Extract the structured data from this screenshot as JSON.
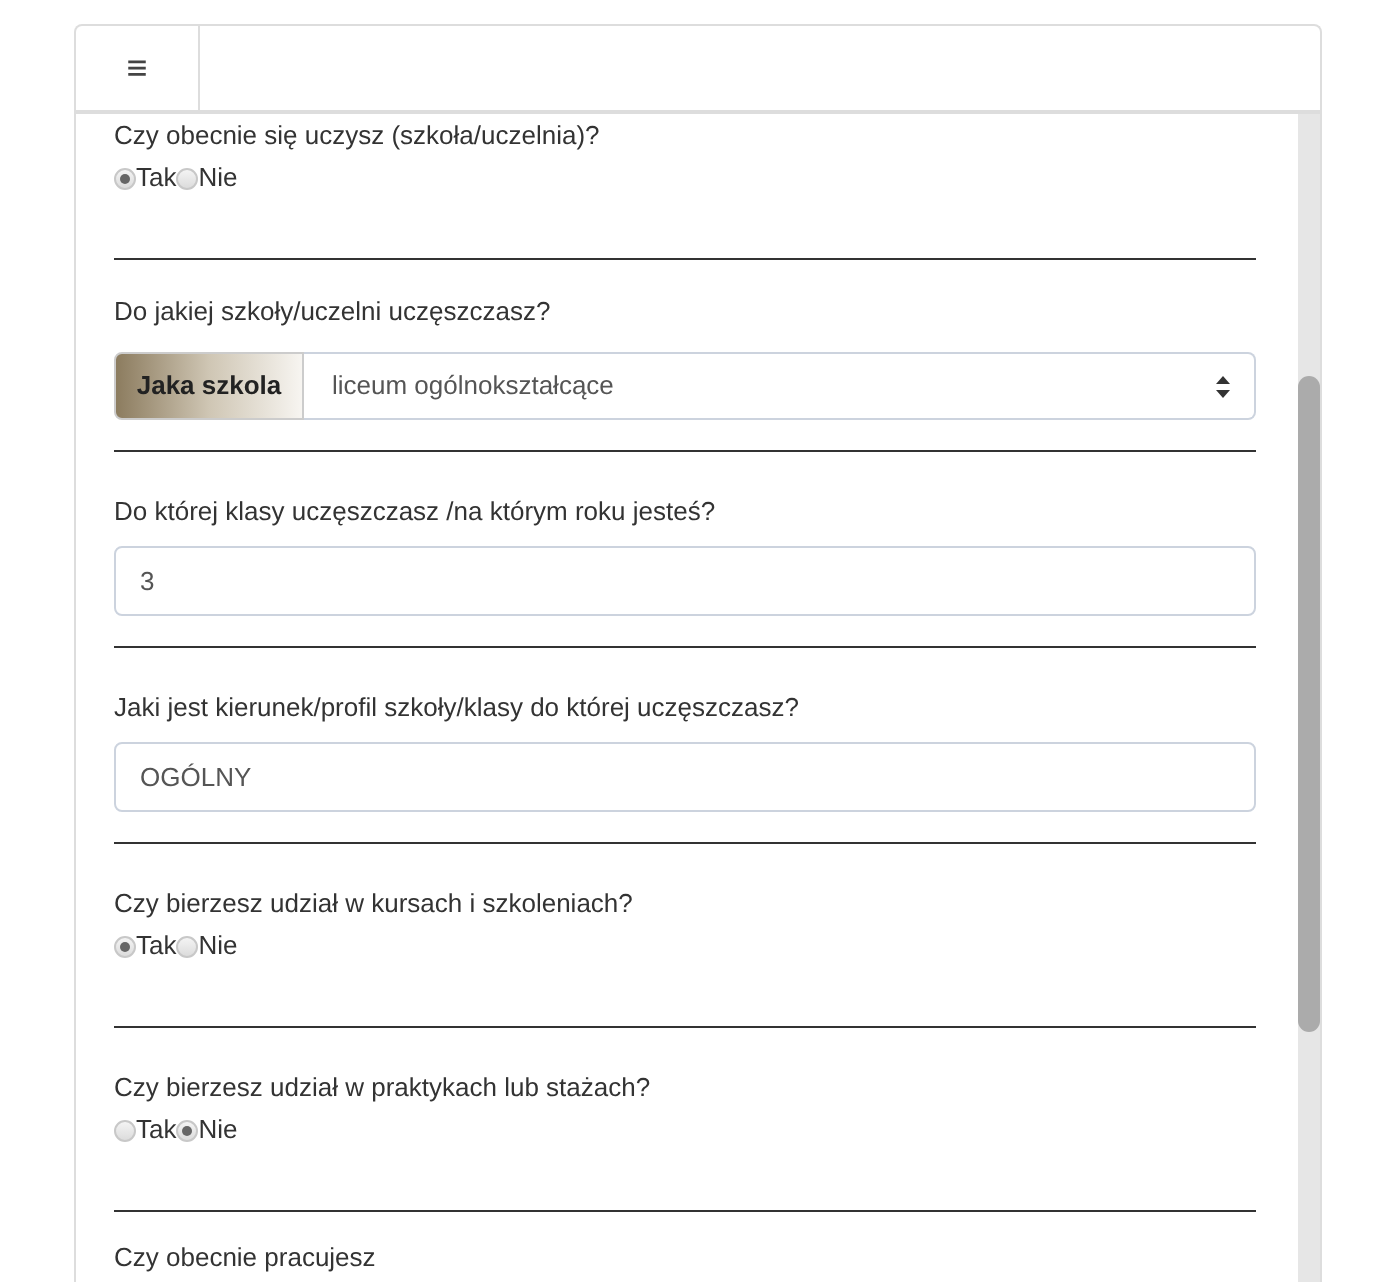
{
  "header": {
    "menu_icon": "≡"
  },
  "questions": [
    {
      "kind": "radio",
      "label": "Czy obecnie się uczysz (szkoła/uczelnia)?",
      "options": [
        {
          "label": "Tak",
          "selected": true
        },
        {
          "label": "Nie",
          "selected": false
        }
      ]
    },
    {
      "kind": "select",
      "label": "Do jakiej szkoły/uczelni uczęszczasz?",
      "addon": "Jaka szkola",
      "value": "liceum ogólnokształcące"
    },
    {
      "kind": "text",
      "label": "Do której klasy uczęszczasz /na którym roku jesteś?",
      "value": "3"
    },
    {
      "kind": "text",
      "label": "Jaki jest kierunek/profil szkoły/klasy do której uczęszczasz?",
      "value": "OGÓLNY"
    },
    {
      "kind": "radio",
      "label": "Czy bierzesz udział w kursach i szkoleniach?",
      "options": [
        {
          "label": "Tak",
          "selected": true
        },
        {
          "label": "Nie",
          "selected": false
        }
      ]
    },
    {
      "kind": "radio",
      "label": "Czy bierzesz udział w praktykach lub stażach?",
      "options": [
        {
          "label": "Tak",
          "selected": false
        },
        {
          "label": "Nie",
          "selected": true
        }
      ]
    },
    {
      "kind": "label",
      "label": "Czy obecnie pracujesz"
    }
  ]
}
